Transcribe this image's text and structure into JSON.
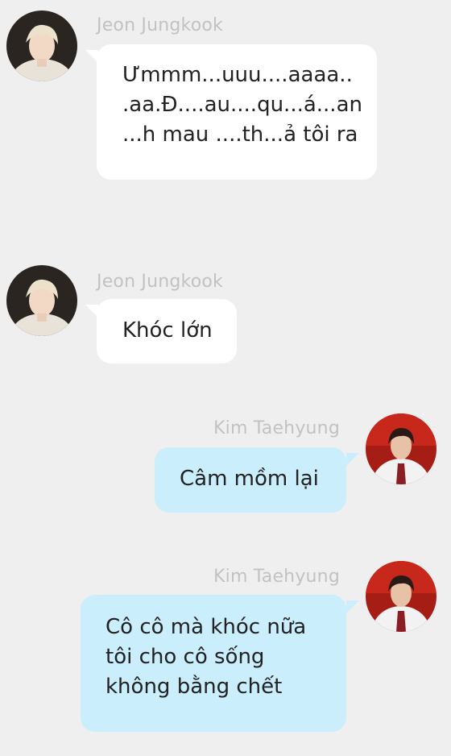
{
  "colors": {
    "background": "#efefef",
    "incoming_bubble": "#ffffff",
    "outgoing_bubble": "#cbeefc",
    "sender_name": "#c2c2c2",
    "message_text": "#222222"
  },
  "messages": [
    {
      "side": "left",
      "sender": "Jeon Jungkook",
      "avatar_icon": "avatar-icon",
      "lines": [
        "Ưmmm...uuu....aaaa..",
        ".aa.Đ....au....qu...á...an",
        "...h mau ....th...ả tôi ra"
      ]
    },
    {
      "side": "left",
      "sender": "Jeon Jungkook",
      "avatar_icon": "avatar-icon",
      "lines": [
        "Khóc lớn"
      ]
    },
    {
      "side": "right",
      "sender": "Kim Taehyung",
      "avatar_icon": "avatar-icon",
      "lines": [
        "Câm mồm lại"
      ]
    },
    {
      "side": "right",
      "sender": "Kim Taehyung",
      "avatar_icon": "avatar-icon",
      "lines": [
        "Cô cô mà khóc nữa",
        "tôi cho cô sống",
        "không bằng chết"
      ]
    }
  ]
}
